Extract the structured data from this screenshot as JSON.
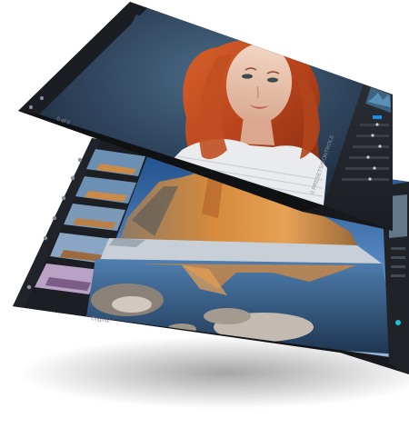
{
  "colors": {
    "app_bg": "#16181c",
    "panel_bg": "#1e2126",
    "accent": "#1d8fe0",
    "accent_cyan": "#19c3d6",
    "page_bg": "#ffffff"
  },
  "top_app": {
    "filmstrip_counter": "0 of 0",
    "panel_footer_label": "0 PRESETS/CONTROLS"
  },
  "bottom_app": {
    "footer_label": "Original"
  },
  "icons": [
    "gear-icon",
    "grid-icon",
    "histogram-icon",
    "preset-icon",
    "slider-icon",
    "compare-icon"
  ]
}
